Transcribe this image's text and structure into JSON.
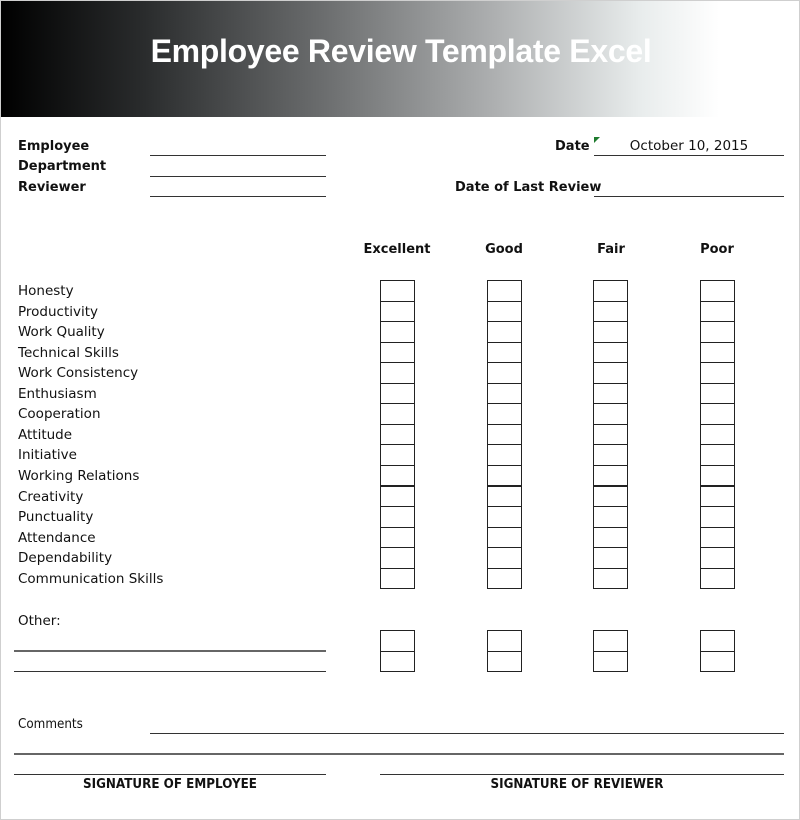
{
  "header": {
    "title": "Employee Review Template Excel"
  },
  "info": {
    "employee_label": "Employee",
    "department_label": "Department",
    "reviewer_label": "Reviewer",
    "date_label": "Date",
    "date_value": "October 10, 2015",
    "last_review_label": "Date of Last Review"
  },
  "ratings": {
    "columns": [
      "Excellent",
      "Good",
      "Fair",
      "Poor"
    ],
    "criteria": [
      "Honesty",
      "Productivity",
      "Work Quality",
      "Technical Skills",
      "Work Consistency",
      "Enthusiasm",
      "Cooperation",
      "Attitude",
      "Initiative",
      "Working Relations",
      "Creativity",
      "Punctuality",
      "Attendance",
      "Dependability",
      "Communication Skills"
    ],
    "other_label": "Other:"
  },
  "comments_label": "Comments",
  "signatures": {
    "employee": "SIGNATURE OF EMPLOYEE",
    "reviewer": "SIGNATURE OF REVIEWER"
  },
  "colors": {
    "date_marker": "#1e7b2e"
  }
}
